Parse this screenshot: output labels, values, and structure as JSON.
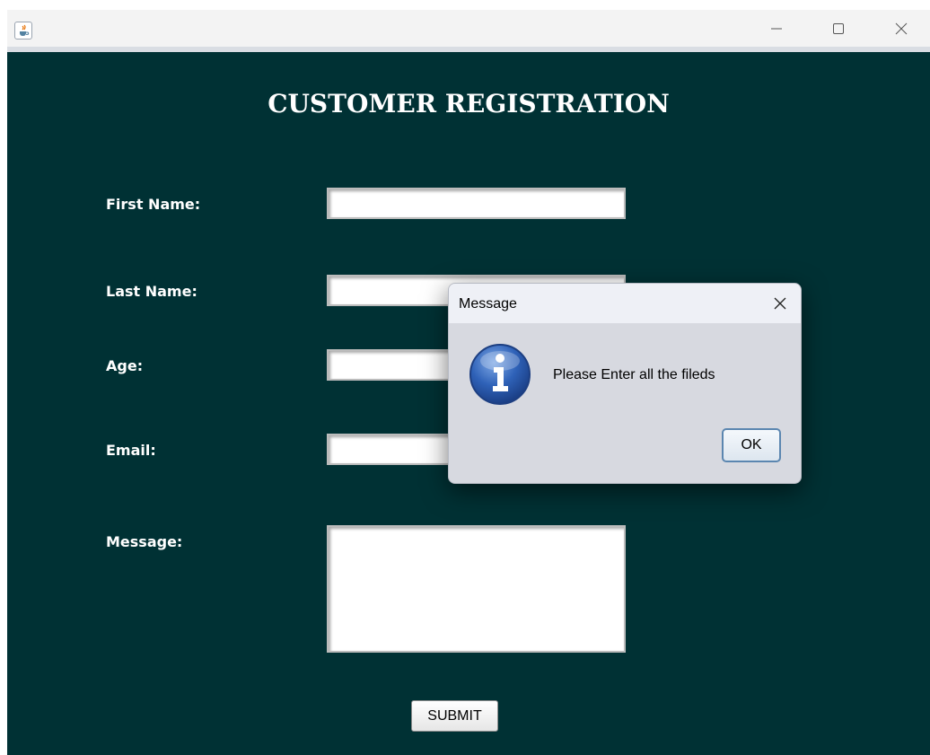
{
  "window": {
    "heading": "CUSTOMER REGISTRATION"
  },
  "form": {
    "fields": [
      {
        "label": "First Name:",
        "value": ""
      },
      {
        "label": "Last Name:",
        "value": ""
      },
      {
        "label": "Age:",
        "value": ""
      },
      {
        "label": "Email:",
        "value": ""
      },
      {
        "label": "Message:",
        "value": ""
      }
    ],
    "submit_label": "SUBMIT"
  },
  "dialog": {
    "title": "Message",
    "message": "Please Enter all the fileds",
    "ok_label": "OK",
    "icon": "info-icon"
  },
  "icons": {
    "app": "java-cup-icon",
    "minimize": "minimize-icon",
    "maximize": "maximize-icon",
    "close": "close-icon"
  },
  "colors": {
    "background": "#003134",
    "dialog_bg": "#d7d9e0",
    "info_blue": "#2a5caa"
  }
}
